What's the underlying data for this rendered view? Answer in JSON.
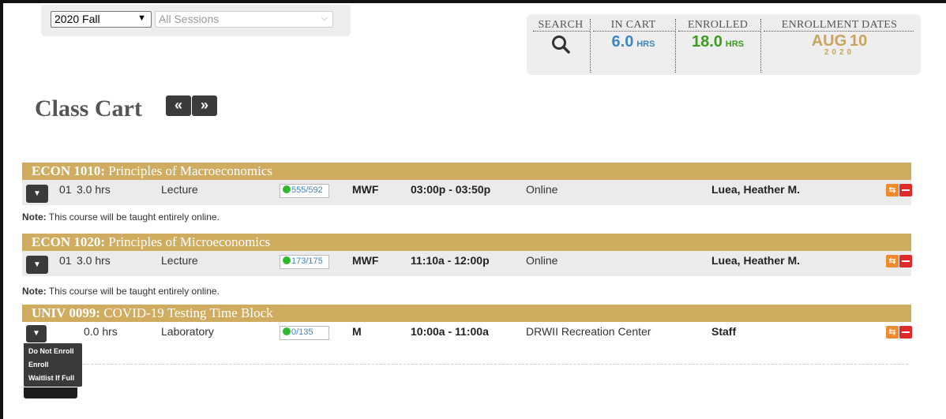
{
  "term_selector": {
    "selected": "2020 Fall"
  },
  "session_selector": {
    "selected": "All Sessions"
  },
  "stats": {
    "search_label": "SEARCH",
    "in_cart_label": "IN CART",
    "in_cart_value": "6.0",
    "in_cart_unit": "HRS",
    "enrolled_label": "ENROLLED",
    "enrolled_value": "18.0",
    "enrolled_unit": "HRS",
    "dates_label": "ENROLLMENT DATES",
    "date_month": "AUG",
    "date_day": "10",
    "date_year": "2020",
    "colors": {
      "blue": "#3d86c6",
      "green": "#3d9d1f",
      "gold": "#c8a55e"
    }
  },
  "page_title": "Class Cart",
  "nav": {
    "prev": "«",
    "next": "»"
  },
  "courses": [
    {
      "code": "ECON 1010:",
      "title": "Principles of Macroeconomics",
      "section": "01",
      "hours": "3.0 hrs",
      "type": "Lecture",
      "seats": "555/592",
      "days": "MWF",
      "time": "03:00p - 03:50p",
      "location": "Online",
      "instructor": "Luea, Heather M.",
      "note_label": "Note:",
      "note": "This course will be taught entirely online."
    },
    {
      "code": "ECON 1020:",
      "title": "Principles of Microeconomics",
      "section": "01",
      "hours": "3.0 hrs",
      "type": "Lecture",
      "seats": "173/175",
      "days": "MWF",
      "time": "11:10a - 12:00p",
      "location": "Online",
      "instructor": "Luea, Heather M.",
      "note_label": "Note:",
      "note": "This course will be taught entirely online."
    },
    {
      "code": "UNIV 0099:",
      "title": "COVID-19 Testing Time Block",
      "hours": "0.0 hrs",
      "type": "Laboratory",
      "seats": "0/135",
      "days": "M",
      "time": "10:00a - 11:00a",
      "location": "DRWII Recreation Center",
      "instructor": "Staff"
    }
  ],
  "enroll_menu": {
    "options": [
      "Do Not Enroll",
      "Enroll",
      "Waitlist If Full"
    ]
  }
}
